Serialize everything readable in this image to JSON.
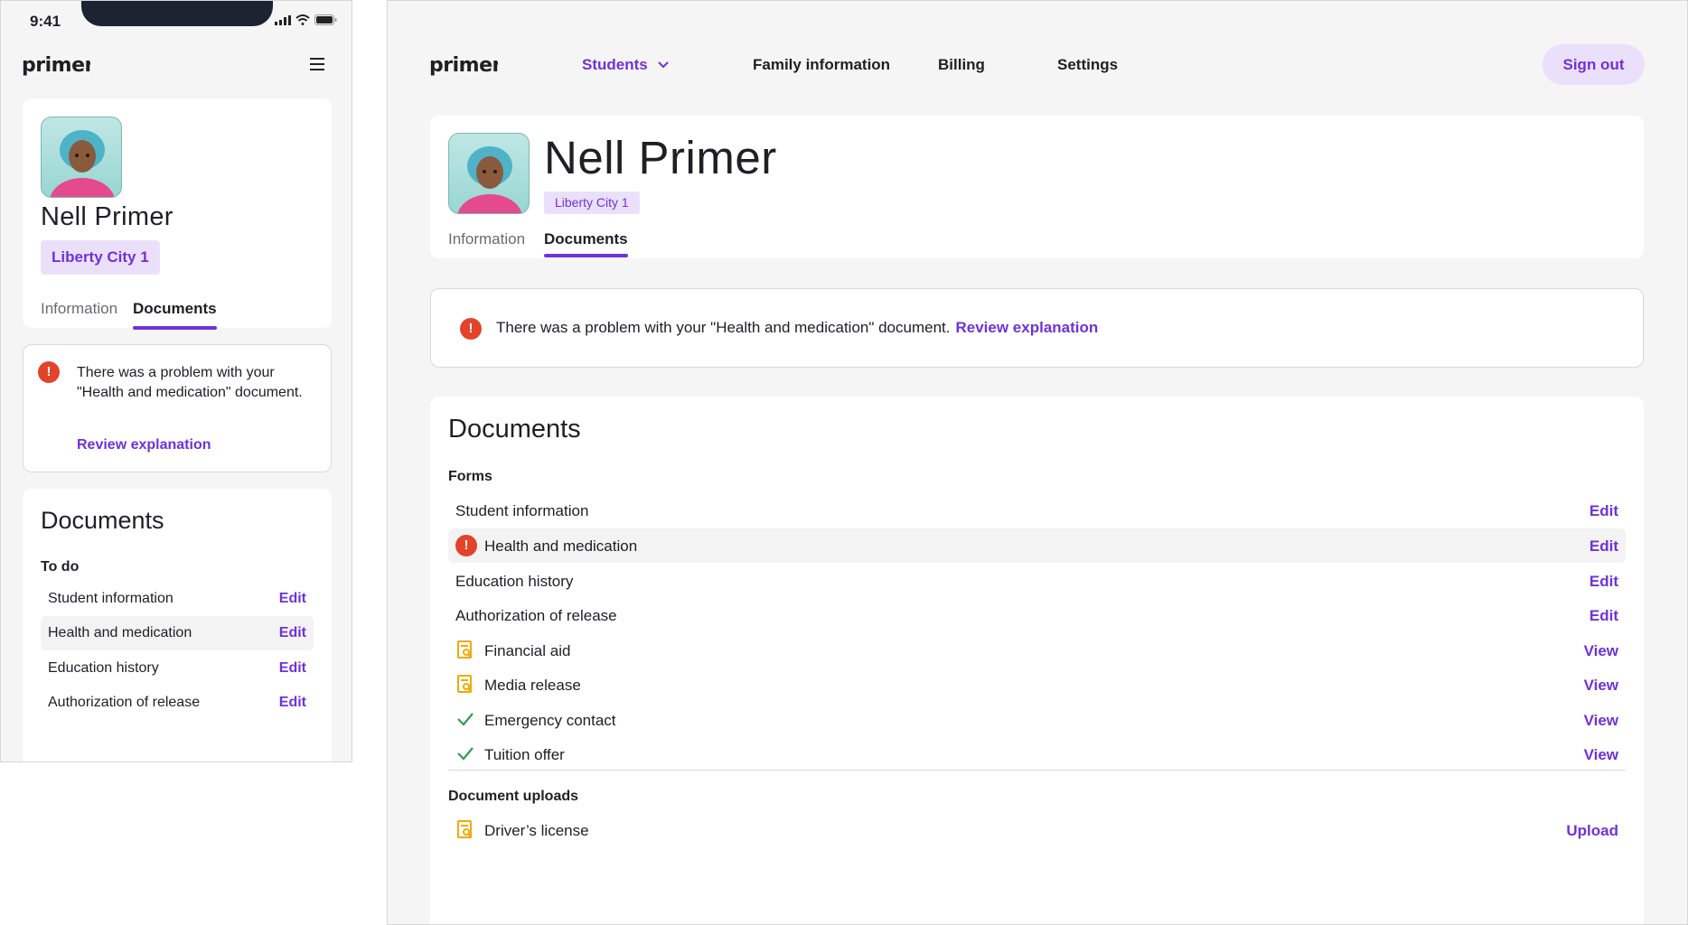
{
  "brand": {
    "logo_text": "primer",
    "accent": "#6f32d9",
    "error": "#e2432a",
    "success": "#2e9b4f",
    "warning": "#f2a900"
  },
  "mobile": {
    "status_time": "9:41",
    "student": {
      "name": "Nell Primer",
      "campus": "Liberty City 1"
    },
    "tabs": [
      {
        "label": "Information"
      },
      {
        "label": "Documents"
      }
    ],
    "alert": {
      "message": "There was a problem with your \"Health and medication\" document.",
      "link": "Review explanation"
    },
    "documents": {
      "title": "Documents",
      "section": "To do",
      "rows": [
        {
          "label": "Student information",
          "action": "Edit"
        },
        {
          "label": "Health and medication",
          "action": "Edit"
        },
        {
          "label": "Education history",
          "action": "Edit"
        },
        {
          "label": "Authorization of release",
          "action": "Edit"
        }
      ]
    }
  },
  "desktop": {
    "nav": [
      {
        "label": "Students"
      },
      {
        "label": "Family information"
      },
      {
        "label": "Billing"
      },
      {
        "label": "Settings"
      }
    ],
    "sign_out": "Sign out",
    "student": {
      "name": "Nell Primer",
      "campus": "Liberty City 1"
    },
    "tabs": [
      {
        "label": "Information"
      },
      {
        "label": "Documents"
      }
    ],
    "alert": {
      "message": "There was a problem with your \"Health and medication\" document.",
      "link": "Review explanation"
    },
    "documents": {
      "title": "Documents",
      "forms_title": "Forms",
      "forms": [
        {
          "label": "Student information",
          "action": "Edit",
          "icon": "none"
        },
        {
          "label": "Health and medication",
          "action": "Edit",
          "icon": "error-icon"
        },
        {
          "label": "Education history",
          "action": "Edit",
          "icon": "none"
        },
        {
          "label": "Authorization of release",
          "action": "Edit",
          "icon": "none"
        },
        {
          "label": "Financial aid",
          "action": "View",
          "icon": "document-review-icon"
        },
        {
          "label": "Media release",
          "action": "View",
          "icon": "document-review-icon"
        },
        {
          "label": "Emergency contact",
          "action": "View",
          "icon": "checkmark-icon"
        },
        {
          "label": "Tuition offer",
          "action": "View",
          "icon": "checkmark-icon"
        }
      ],
      "uploads_title": "Document uploads",
      "uploads": [
        {
          "label": "Driver’s license",
          "action": "Upload",
          "icon": "document-review-icon"
        }
      ]
    }
  }
}
